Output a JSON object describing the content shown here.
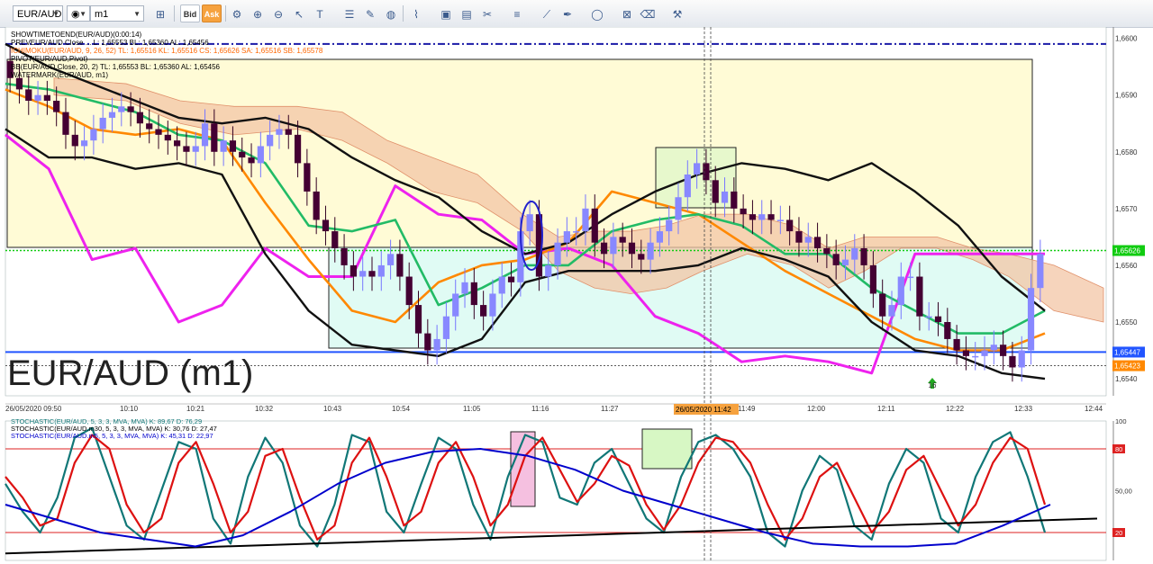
{
  "toolbar": {
    "symbol": "EUR/AUD",
    "chart_type_icon": "candles-icon",
    "timeframe": "m1",
    "bid_label": "Bid",
    "ask_label": "Ask"
  },
  "chart_data": [
    {
      "type": "candlestick",
      "title": "EUR/AUD (m1)",
      "indicator_labels": [
        {
          "text": "SHOWTIMETOEND(EUR/AUD)(0:00:14)",
          "color": "#000000"
        },
        {
          "text": "PREVEUR/AUD Close ... L: 1,65553 BL: 1,65360 AL: 1,65456",
          "color": "#000000"
        },
        {
          "text": "ICHIMOKU(EUR/AUD, 9, 26, 52) TL: 1,65516 KL: 1,65516 CS: 1,65626 SA: 1,65516 SB: 1,65578",
          "color": "#ff6600"
        },
        {
          "text": "PIVOT(EUR/AUD,Pivot)",
          "color": "#000000"
        },
        {
          "text": "BB(EUR/AUD,Close, 20, 2) TL: 1,65553 BL: 1,65360 AL: 1,65456",
          "color": "#000000"
        },
        {
          "text": "WATERMARK(EUR/AUD, m1)",
          "color": "#000000"
        }
      ],
      "x_tick_labels": [
        "26/05/2020 09:50",
        "10:10",
        "10:21",
        "10:32",
        "10:43",
        "10:54",
        "11:05",
        "11:16",
        "11:27",
        "11:49",
        "12:00",
        "12:11",
        "12:22",
        "12:33",
        "12:44"
      ],
      "crosshair_time": "26/05/2020 11:42",
      "y_ticks": [
        "1,6600",
        "1,6590",
        "1,6580",
        "1,6570",
        "1,6560",
        "1,6550",
        "1,6540"
      ],
      "ylim": [
        1.6537,
        1.6602
      ],
      "price_markers": [
        {
          "value": "1,65626",
          "color": "#11cc11"
        },
        {
          "value": "1,65447",
          "color": "#2255ff"
        },
        {
          "value": "1,65423",
          "color": "#ff8800"
        }
      ],
      "resistance_line": 1.6599,
      "current_price": 1.65626,
      "support_line": 1.65447,
      "lower_ref": 1.65423,
      "annotation": "16",
      "candles_close": [
        1.6593,
        1.6591,
        1.6589,
        1.659,
        1.6589,
        1.6587,
        1.6583,
        1.6581,
        1.6582,
        1.6584,
        1.6586,
        1.6587,
        1.6588,
        1.6587,
        1.6585,
        1.6584,
        1.6583,
        1.6582,
        1.6581,
        1.658,
        1.6581,
        1.6585,
        1.658,
        1.6582,
        1.658,
        1.6579,
        1.6578,
        1.6581,
        1.6583,
        1.6584,
        1.6583,
        1.6578,
        1.6573,
        1.6568,
        1.6566,
        1.6563,
        1.656,
        1.6558,
        1.6559,
        1.6558,
        1.656,
        1.6562,
        1.6558,
        1.6553,
        1.6548,
        1.6545,
        1.6547,
        1.6551,
        1.6555,
        1.6557,
        1.6553,
        1.6551,
        1.6555,
        1.6558,
        1.6557,
        1.6566,
        1.6569,
        1.6558,
        1.656,
        1.6564,
        1.6566,
        1.6566,
        1.657,
        1.6564,
        1.6562,
        1.6565,
        1.6564,
        1.6562,
        1.6561,
        1.6564,
        1.6566,
        1.6568,
        1.6572,
        1.6576,
        1.6578,
        1.6575,
        1.6571,
        1.6573,
        1.657,
        1.6569,
        1.6568,
        1.6569,
        1.6568,
        1.6568,
        1.6566,
        1.6564,
        1.6565,
        1.6563,
        1.6562,
        1.656,
        1.6561,
        1.6563,
        1.656,
        1.6555,
        1.6551,
        1.6553,
        1.6558,
        1.6558,
        1.6551,
        1.6551,
        1.655,
        1.6547,
        1.6545,
        1.6544,
        1.6544,
        1.6545,
        1.6546,
        1.6544,
        1.6542,
        1.6545,
        1.6556,
        1.6562
      ],
      "overlays": {
        "bollinger_upper": [
          1.6599,
          1.6595,
          1.6592,
          1.6589,
          1.6586,
          1.6585,
          1.6586,
          1.6584,
          1.6579,
          1.6575,
          1.6572,
          1.6566,
          1.6562,
          1.6564,
          1.6569,
          1.6573,
          1.6576,
          1.6578,
          1.6577,
          1.6575,
          1.6578,
          1.6573,
          1.6567,
          1.6558,
          1.6552
        ],
        "bollinger_lower": [
          1.6584,
          1.6579,
          1.6579,
          1.6577,
          1.6578,
          1.6576,
          1.6562,
          1.6552,
          1.6546,
          1.6545,
          1.6544,
          1.6547,
          1.6557,
          1.6559,
          1.6559,
          1.6559,
          1.656,
          1.6563,
          1.6561,
          1.6558,
          1.655,
          1.6545,
          1.6544,
          1.6541,
          1.654
        ],
        "fast_ma_green": [
          1.6592,
          1.6591,
          1.6589,
          1.6587,
          1.6583,
          1.6582,
          1.6578,
          1.6567,
          1.6566,
          1.6568,
          1.6553,
          1.6556,
          1.656,
          1.656,
          1.6566,
          1.6568,
          1.6569,
          1.6567,
          1.6562,
          1.6562,
          1.6556,
          1.6552,
          1.6548,
          1.6548,
          1.6552
        ],
        "slow_ma_orange": [
          1.6591,
          1.6588,
          1.6584,
          1.6583,
          1.6584,
          1.6582,
          1.6571,
          1.6561,
          1.6552,
          1.655,
          1.6557,
          1.656,
          1.6561,
          1.6564,
          1.6573,
          1.6571,
          1.6569,
          1.6564,
          1.6559,
          1.6555,
          1.6551,
          1.6547,
          1.6545,
          1.6545,
          1.6548
        ],
        "magenta_line": [
          1.6583,
          1.6577,
          1.6561,
          1.6563,
          1.655,
          1.6553,
          1.6563,
          1.6558,
          1.6558,
          1.6574,
          1.6569,
          1.6568,
          1.6562,
          1.6563,
          1.656,
          1.6551,
          1.6548,
          1.6543,
          1.6544,
          1.6543,
          1.6541,
          1.6562,
          1.6562,
          1.6562,
          1.6562
        ]
      }
    },
    {
      "type": "line",
      "title": "",
      "legend": [
        {
          "text": "STOCHASTIC(EUR/AUD, 5, 3, 3, MVA, MVA)  K: 89,67  D: 76,29",
          "color": "#117777"
        },
        {
          "text": "STOCHASTIC(EUR/AUD.m30, 5, 3, 3, MVA, MVA)  K: 30,76  D: 27,47",
          "color": "#000000"
        },
        {
          "text": "STOCHASTIC(EUR/AUD.m5, 5, 3, 3, MVA, MVA)  K: 45,31  D: 22,97",
          "color": "#0000cc"
        }
      ],
      "y_ticks": [
        "100",
        "80",
        "50,00",
        "20"
      ],
      "ylim": [
        0,
        100
      ],
      "levels": [
        80,
        20
      ],
      "series": [
        {
          "name": "K",
          "color": "#117777",
          "values": [
            55,
            35,
            20,
            45,
            88,
            95,
            60,
            25,
            15,
            50,
            85,
            80,
            30,
            12,
            60,
            88,
            70,
            25,
            10,
            40,
            90,
            85,
            35,
            20,
            55,
            88,
            80,
            40,
            15,
            60,
            90,
            85,
            45,
            40,
            70,
            80,
            55,
            30,
            20,
            60,
            85,
            90,
            80,
            60,
            20,
            10,
            50,
            75,
            65,
            25,
            15,
            55,
            80,
            70,
            30,
            20,
            60,
            85,
            92,
            60,
            20
          ]
        },
        {
          "name": "D",
          "color": "#dd1111",
          "values": [
            60,
            45,
            25,
            30,
            70,
            90,
            80,
            40,
            20,
            30,
            70,
            85,
            55,
            20,
            35,
            75,
            80,
            45,
            15,
            25,
            70,
            88,
            60,
            25,
            35,
            70,
            85,
            60,
            25,
            40,
            75,
            88,
            65,
            42,
            55,
            75,
            68,
            40,
            22,
            40,
            70,
            88,
            85,
            70,
            40,
            15,
            30,
            60,
            70,
            45,
            20,
            35,
            65,
            75,
            50,
            25,
            40,
            70,
            88,
            80,
            40
          ]
        },
        {
          "name": "",
          "color": "#000000",
          "values": [
            5,
            6,
            7,
            8,
            9,
            10,
            11,
            12,
            13,
            14,
            15,
            16,
            17,
            18,
            19,
            20,
            21,
            22,
            23,
            24,
            25,
            26,
            27,
            28,
            29,
            30
          ]
        },
        {
          "name": "",
          "color": "#0000cc",
          "values": [
            40,
            30,
            20,
            15,
            10,
            18,
            35,
            55,
            70,
            78,
            80,
            75,
            65,
            50,
            40,
            30,
            20,
            12,
            10,
            10,
            12,
            25,
            40
          ]
        }
      ]
    }
  ]
}
